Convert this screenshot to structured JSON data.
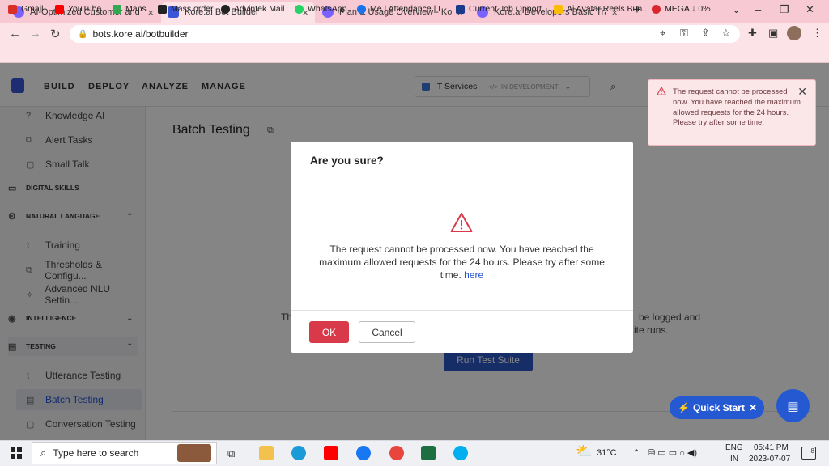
{
  "browser": {
    "tabs": [
      {
        "title": "AI-Optimized Customer and Emp",
        "color": "#7b61ff"
      },
      {
        "title": "Kore.ai Bot Builder",
        "color": "#3b55d9"
      },
      {
        "title": "Plan & Usage Overview - Kore.ai",
        "color": "#7b61ff"
      },
      {
        "title": "Kore.ai Developers Basic Training",
        "color": "#7b61ff"
      }
    ],
    "url": "bots.kore.ai/botbuilder",
    "bookmarks": [
      {
        "label": "Gmail",
        "color": "#d93025"
      },
      {
        "label": "YouTube",
        "color": "#ff0000"
      },
      {
        "label": "Maps",
        "color": "#34a853"
      },
      {
        "label": "Mass order",
        "color": "#222222"
      },
      {
        "label": "Advintek Mail",
        "color": "#222222"
      },
      {
        "label": "WhatsApp",
        "color": "#25d366"
      },
      {
        "label": "Me | Attendance | L...",
        "color": "#1a73e8"
      },
      {
        "label": "Current Job Opport...",
        "color": "#1a3b8c"
      },
      {
        "label": "Ai Avatar Reels Bun...",
        "color": "#fbbc04"
      },
      {
        "label": "MEGA ↓ 0%",
        "color": "#d9272e"
      }
    ]
  },
  "app": {
    "nav": [
      "BUILD",
      "DEPLOY",
      "ANALYZE",
      "MANAGE"
    ],
    "bot_name": "IT Services",
    "bot_status": "IN DEVELOPMENT"
  },
  "sidebar": {
    "items": [
      {
        "label": "Knowledge AI",
        "icon": "help-circle-icon"
      },
      {
        "label": "Alert Tasks",
        "icon": "alert-tasks-icon"
      },
      {
        "label": "Small Talk",
        "icon": "chat-icon"
      }
    ],
    "sec_digital": "DIGITAL SKILLS",
    "sec_nl": "NATURAL LANGUAGE",
    "nl_items": [
      {
        "label": "Training",
        "icon": "training-icon"
      },
      {
        "label": "Thresholds & Configu...",
        "icon": "thresholds-icon"
      },
      {
        "label": "Advanced NLU Settin...",
        "icon": "nlu-settings-icon"
      }
    ],
    "sec_intelligence": "INTELLIGENCE",
    "sec_testing": "TESTING",
    "testing_items": [
      {
        "label": "Utterance Testing",
        "icon": "utterance-icon"
      },
      {
        "label": "Batch Testing",
        "icon": "batch-icon"
      },
      {
        "label": "Conversation Testing",
        "icon": "conversation-icon"
      }
    ]
  },
  "main": {
    "title": "Batch Testing",
    "bg_left": "Th",
    "bg_right1": "be logged and",
    "bg_right2": "ite runs.",
    "run_button": "Run Test Suite"
  },
  "modal": {
    "title": "Are you sure?",
    "message": "The request cannot be processed now. You have reached the maximum allowed requests for the 24 hours. Please try after some time.",
    "link": "here",
    "ok": "OK",
    "cancel": "Cancel"
  },
  "toast": {
    "message": "The request cannot be processed now. You have reached the maximum allowed requests for the 24 hours. Please try after some time."
  },
  "quick_start": "Quick Start",
  "taskbar": {
    "search_placeholder": "Type here to search",
    "temperature": "31°C",
    "lang1": "ENG",
    "lang2": "IN",
    "time": "05:41 PM",
    "date": "2023-07-07",
    "notifications": "8"
  },
  "colors": {
    "accent": "#2b56c8",
    "danger": "#d93a4a",
    "tab_strip": "#f7cad3"
  }
}
